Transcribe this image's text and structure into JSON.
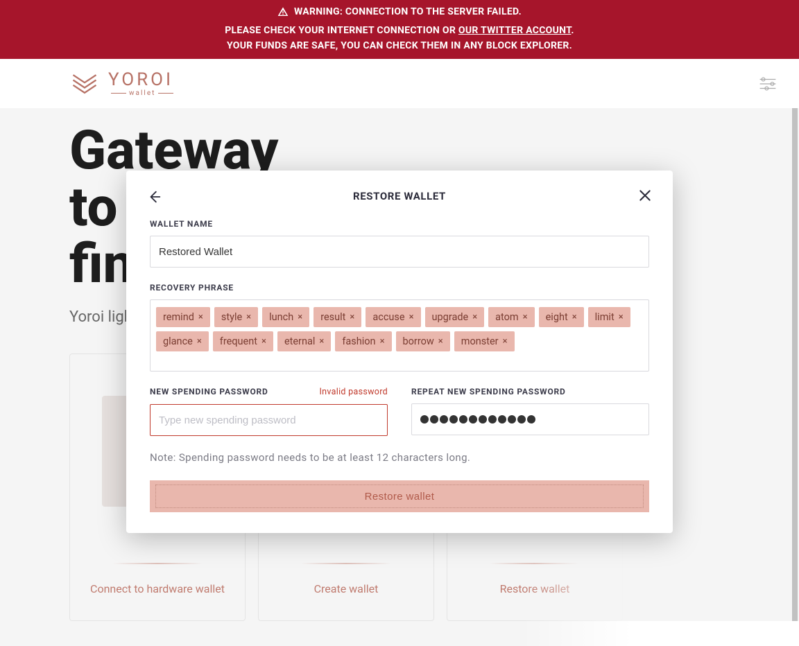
{
  "banner": {
    "line1": "WARNING: CONNECTION TO THE SERVER FAILED.",
    "line2_prefix": "PLEASE CHECK YOUR INTERNET CONNECTION OR ",
    "line2_link": "OUR TWITTER ACCOUNT",
    "line2_suffix": ".",
    "line3": "YOUR FUNDS ARE SAFE, YOU CAN CHECK THEM IN ANY BLOCK EXPLORER."
  },
  "logo": {
    "name": "YOROI",
    "sub": "wallet"
  },
  "hero": {
    "title_line1": "Gateway",
    "title_line2": "to the",
    "title_line3": "financial world",
    "subtitle": "Yoroi light wallet for Cardano"
  },
  "cards": [
    {
      "label": "Connect to hardware wallet"
    },
    {
      "label": "Create wallet"
    },
    {
      "label": "Restore wallet"
    }
  ],
  "modal": {
    "title": "RESTORE WALLET",
    "wallet_name_label": "WALLET NAME",
    "wallet_name_value": "Restored Wallet",
    "recovery_label": "RECOVERY PHRASE",
    "recovery_words": [
      "remind",
      "style",
      "lunch",
      "result",
      "accuse",
      "upgrade",
      "atom",
      "eight",
      "limit",
      "glance",
      "frequent",
      "eternal",
      "fashion",
      "borrow",
      "monster"
    ],
    "chip_close": "×",
    "new_pw_label": "NEW SPENDING PASSWORD",
    "new_pw_placeholder": "Type new spending password",
    "new_pw_error": "Invalid password",
    "repeat_pw_label": "REPEAT NEW SPENDING PASSWORD",
    "repeat_pw_dots": 12,
    "note": "Note: Spending password needs to be at least 12 characters long.",
    "restore_button": "Restore wallet"
  }
}
